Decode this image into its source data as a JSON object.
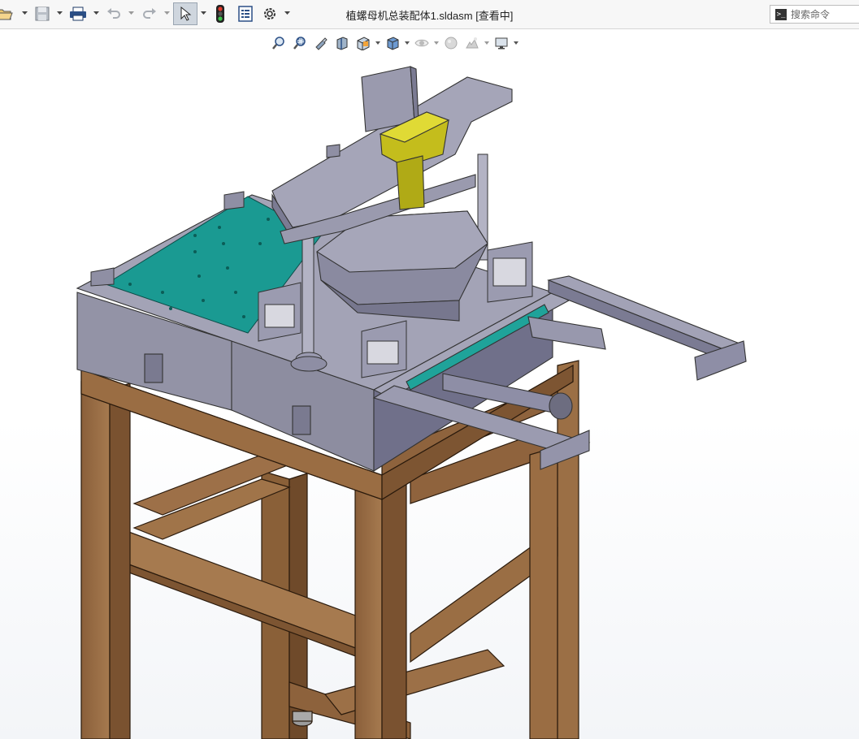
{
  "window": {
    "title": "植螺母机总装配体1.sldasm [查看中]"
  },
  "search": {
    "placeholder": "搜索命令"
  },
  "toolbar_icons": [
    "open-icon",
    "save-icon",
    "print-icon",
    "undo-icon",
    "redo-icon",
    "select-cursor-icon",
    "traffic-light-icon",
    "file-properties-icon",
    "options-gear-icon"
  ],
  "view_toolbar_icons": [
    "zoom-to-fit-icon",
    "zoom-area-icon",
    "previous-view-icon",
    "section-view-icon",
    "view-orientation-icon",
    "display-style-icon",
    "hide-show-icon",
    "edit-appearance-icon",
    "apply-scene-icon",
    "view-settings-icon"
  ],
  "colors": {
    "steel": "#8f8fa4",
    "steel_dark": "#6f6f85",
    "wood": "#9a6f46",
    "teal_plate": "#1a9a92",
    "hopper": "#b7b21e"
  }
}
